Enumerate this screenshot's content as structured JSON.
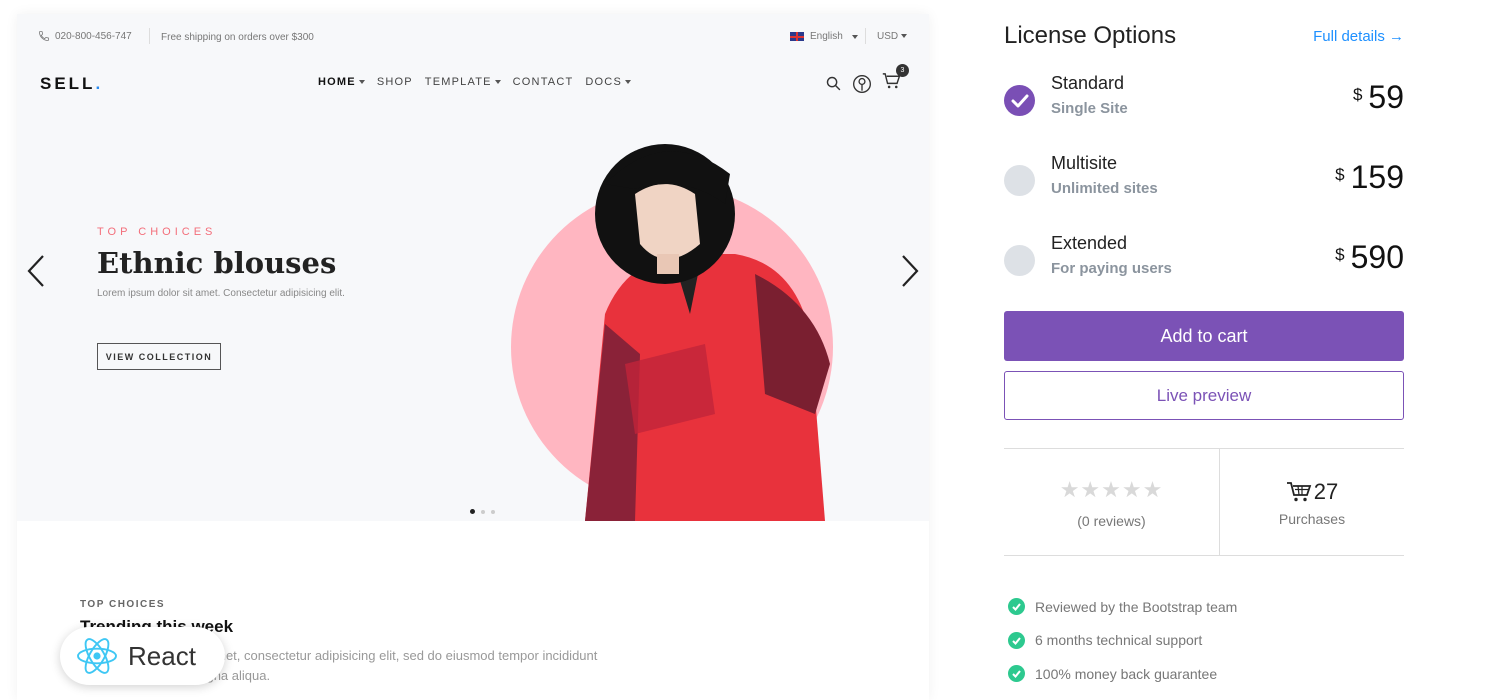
{
  "colors": {
    "accent": "#7b52b6",
    "link": "#1e90ff",
    "success": "#2dc98f",
    "hero_pink": "#ffb6c1",
    "kicker_red": "#f36e7a"
  },
  "preview": {
    "topbar": {
      "phone": "020-800-456-747",
      "shipping": "Free shipping on orders over $300",
      "language": "English",
      "currency": "USD"
    },
    "navbar": {
      "logo": "SELL",
      "logo_dot": ".",
      "nav": [
        "HOME",
        "SHOP",
        "TEMPLATE",
        "CONTACT",
        "DOCS"
      ],
      "cart_count": "3"
    },
    "hero": {
      "kicker": "TOP CHOICES",
      "title": "Ethnic blouses",
      "subtitle": "Lorem ipsum dolor sit amet. Consectetur adipisicing elit.",
      "button": "VIEW COLLECTION",
      "slide_active": 1,
      "slide_count": 3
    },
    "section": {
      "kicker": "TOP CHOICES",
      "title": "Trending this week",
      "paragraph": "Lorem ipsum dolor sit amet, consectetur adipisicing elit, sed do eiusmod tempor incididunt ut labore et dolore magna aliqua."
    },
    "react_badge": "React"
  },
  "panel": {
    "title": "License Options",
    "full_details": "Full details →",
    "options": [
      {
        "name": "Standard",
        "sub": "Single Site",
        "currency": "$",
        "price": "59",
        "selected": true
      },
      {
        "name": "Multisite",
        "sub": "Unlimited sites",
        "currency": "$",
        "price": "159",
        "selected": false
      },
      {
        "name": "Extended",
        "sub": "For paying users",
        "currency": "$",
        "price": "590",
        "selected": false
      }
    ],
    "add_to_cart": "Add to cart",
    "live_preview": "Live preview",
    "rating_stars": "★★★★★",
    "rating_value": 0,
    "reviews": "(0 reviews)",
    "purchases_count": "27",
    "purchases_label": "Purchases",
    "features": [
      "Reviewed by the Bootstrap team",
      "6 months technical support",
      "100% money back guarantee"
    ]
  }
}
